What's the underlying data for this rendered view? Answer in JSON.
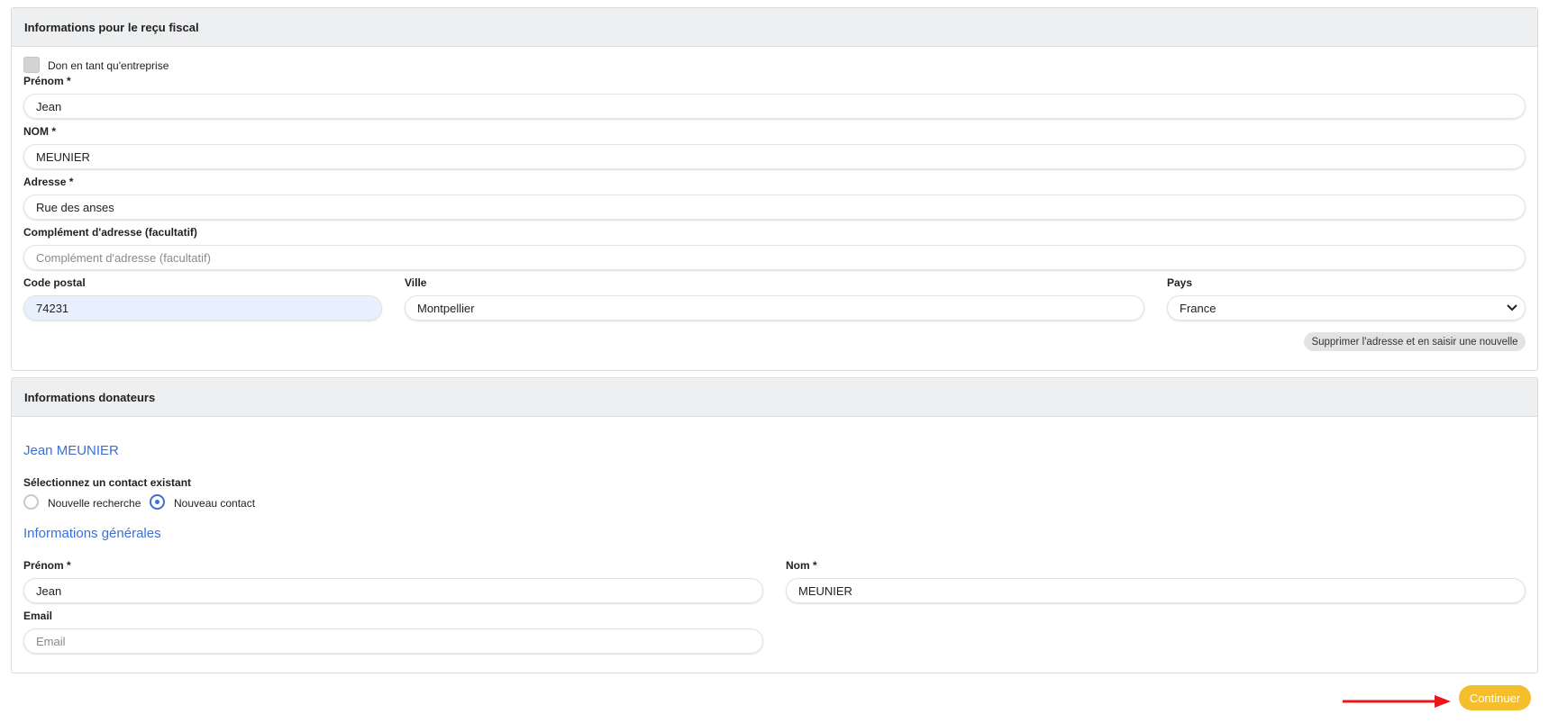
{
  "fiscal": {
    "header": "Informations pour le reçu fiscal",
    "company_checkbox_label": "Don en tant qu'entreprise",
    "firstname_label": "Prénom *",
    "firstname_value": "Jean",
    "lastname_label": "NOM *",
    "lastname_value": "MEUNIER",
    "address_label": "Adresse *",
    "address_value": "Rue des anses",
    "address2_label": "Complément d'adresse (facultatif)",
    "address2_placeholder": "Complément d'adresse (facultatif)",
    "postal_label": "Code postal",
    "postal_value": "74231",
    "city_label": "Ville",
    "city_value": "Montpellier",
    "country_label": "Pays",
    "country_value": "France",
    "reset_address_button": "Supprimer l'adresse et en saisir une nouvelle"
  },
  "donors": {
    "header": "Informations donateurs",
    "donor_name": "Jean MEUNIER",
    "select_contact_label": "Sélectionnez un contact existant",
    "radio_new_search": "Nouvelle recherche",
    "radio_new_contact": "Nouveau contact",
    "general_info_title": "Informations générales",
    "firstname_label": "Prénom *",
    "firstname_value": "Jean",
    "lastname_label": "Nom *",
    "lastname_value": "MEUNIER",
    "email_label": "Email",
    "email_placeholder": "Email"
  },
  "actions": {
    "continue_button": "Continuer"
  },
  "colors": {
    "accent_blue": "#3b6fd8",
    "continue_yellow": "#f4be2c",
    "arrow_red": "#e8171c"
  }
}
